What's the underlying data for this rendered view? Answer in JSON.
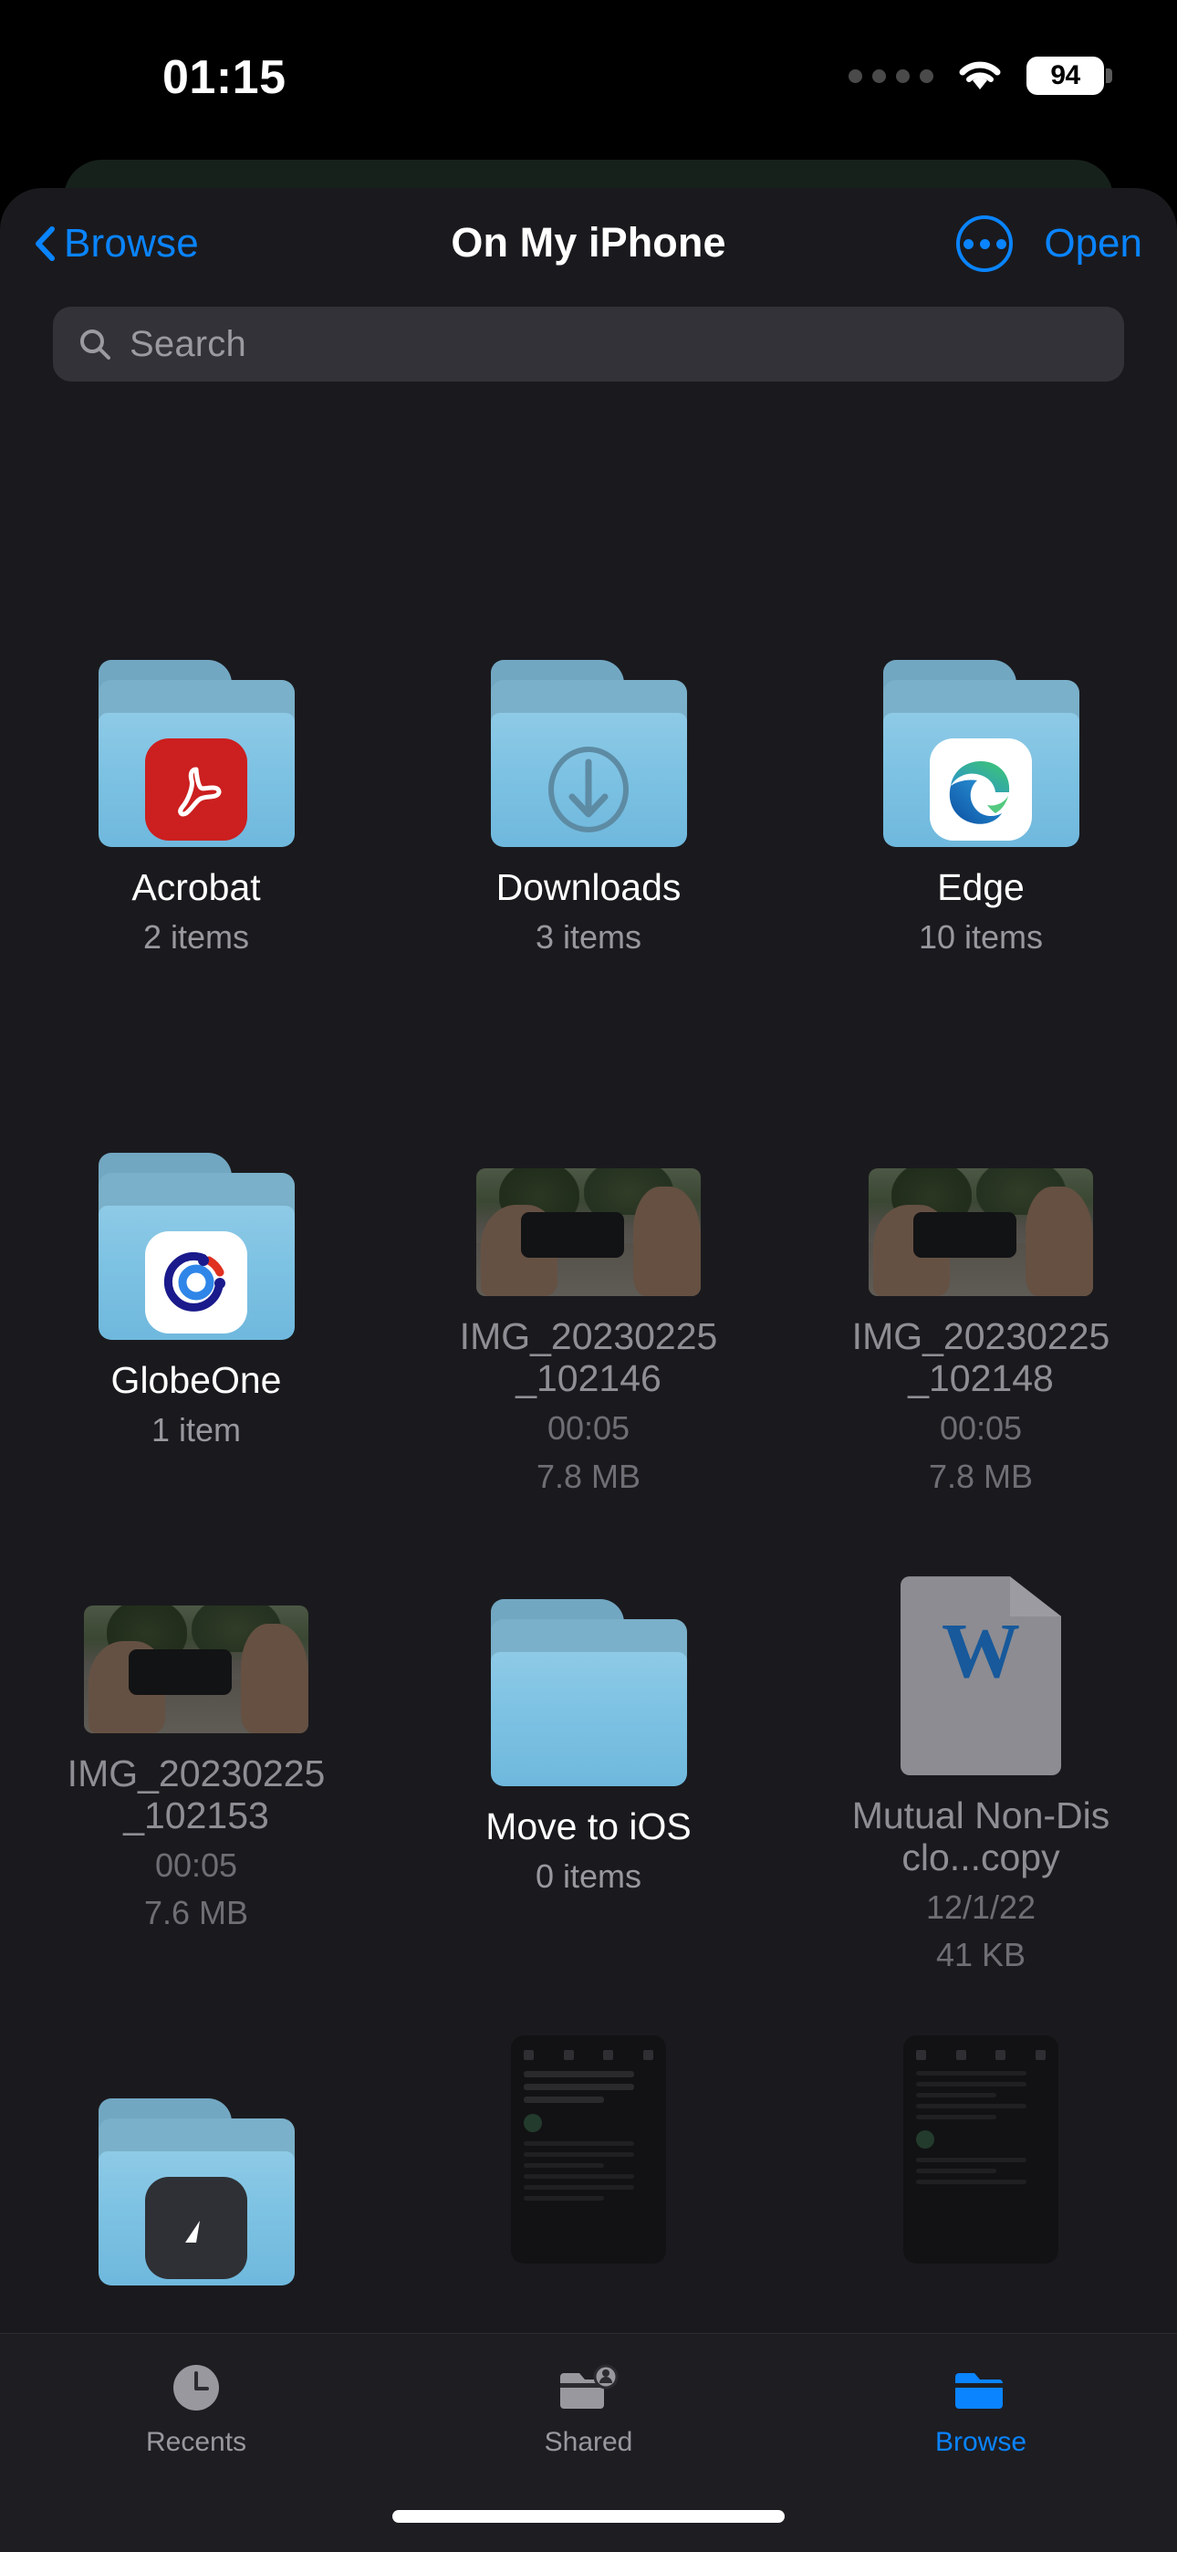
{
  "status_bar": {
    "time": "01:15",
    "battery_level": "94",
    "signal_icon": "signal-dots-icon",
    "wifi_icon": "wifi-icon",
    "battery_icon": "battery-icon"
  },
  "nav_bar": {
    "back_label": "Browse",
    "back_icon": "chevron-left-icon",
    "title": "On My iPhone",
    "more_icon": "ellipsis-circle-icon",
    "open_label": "Open"
  },
  "search": {
    "placeholder": "Search",
    "icon": "search-icon"
  },
  "colors": {
    "accent": "#0a84ff",
    "sheet_background": "#1a1a1e",
    "search_field": "#323238",
    "folder_blue": "#8ecae6",
    "acrobat_red": "#cc1f1f",
    "word_blue": "#17599b",
    "secondary_text": "#98989e"
  },
  "grid": {
    "items": [
      {
        "name": "Acrobat",
        "meta1": "2 items",
        "meta2": "",
        "kind": "folder",
        "icon": "acrobat-app-icon",
        "dimmed": false
      },
      {
        "name": "Downloads",
        "meta1": "3 items",
        "meta2": "",
        "kind": "folder",
        "icon": "download-arrow-icon",
        "dimmed": false
      },
      {
        "name": "Edge",
        "meta1": "10 items",
        "meta2": "",
        "kind": "folder",
        "icon": "edge-app-icon",
        "dimmed": false
      },
      {
        "name": "GlobeOne",
        "meta1": "1 item",
        "meta2": "",
        "kind": "folder",
        "icon": "globeone-app-icon",
        "dimmed": false
      },
      {
        "name": "IMG_20230225_102146",
        "meta1": "00:05",
        "meta2": "7.8 MB",
        "kind": "video",
        "icon": "video-thumbnail",
        "dimmed": true
      },
      {
        "name": "IMG_20230225_102148",
        "meta1": "00:05",
        "meta2": "7.8 MB",
        "kind": "video",
        "icon": "video-thumbnail",
        "dimmed": true
      },
      {
        "name": "IMG_20230225_102153",
        "meta1": "00:05",
        "meta2": "7.6 MB",
        "kind": "video",
        "icon": "video-thumbnail",
        "dimmed": true
      },
      {
        "name": "Move to iOS",
        "meta1": "0 items",
        "meta2": "",
        "kind": "folder",
        "icon": "empty-folder-icon",
        "dimmed": false
      },
      {
        "name": "Mutual Non-Disclo...copy",
        "meta1": "12/1/22",
        "meta2": "41 KB",
        "kind": "document",
        "icon": "word-document-icon",
        "dimmed": true
      }
    ]
  },
  "tab_bar": {
    "tabs": [
      {
        "label": "Recents",
        "icon": "clock-icon",
        "active": false
      },
      {
        "label": "Shared",
        "icon": "shared-folder-icon",
        "active": false
      },
      {
        "label": "Browse",
        "icon": "folder-icon",
        "active": true
      }
    ]
  }
}
